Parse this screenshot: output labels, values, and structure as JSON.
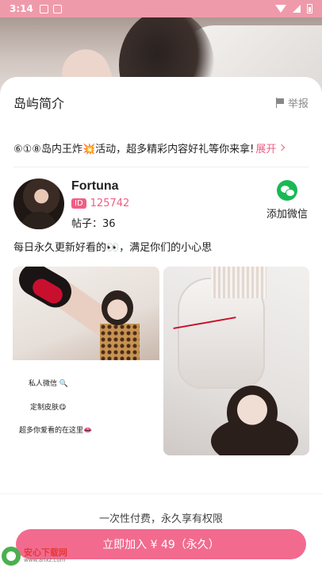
{
  "status_bar": {
    "time": "3:14"
  },
  "section": {
    "title": "岛屿简介",
    "report_label": "举报"
  },
  "promo": {
    "text": "⑥①⑧岛内王炸💥活动，超多精彩内容好礼等你来拿!",
    "expand_label": "展开"
  },
  "profile": {
    "name": "Fortuna",
    "id_badge": "ID",
    "id_value": "125742",
    "posts_label": "帖子：36",
    "wechat_label": "添加微信"
  },
  "bio": "每日永久更新好看的👀，满足你们的小心思",
  "photo_text": {
    "line1": "私人微信 🔍",
    "line2": "定制皮肤😋",
    "line3": "超多你爱看的在这里👄"
  },
  "footer": {
    "note": "一次性付费，永久享有权限",
    "button_label": "立即加入 ¥ 49（永久）"
  },
  "watermark": {
    "title": "安心下载网",
    "url": "www.anxz.com"
  },
  "colors": {
    "accent": "#f26b8f",
    "wechat": "#19b955",
    "status_bar": "#ef9aaa"
  },
  "icons": {
    "report": "flag-icon",
    "expand": "chevron-right-icon",
    "wechat": "wechat-icon"
  }
}
